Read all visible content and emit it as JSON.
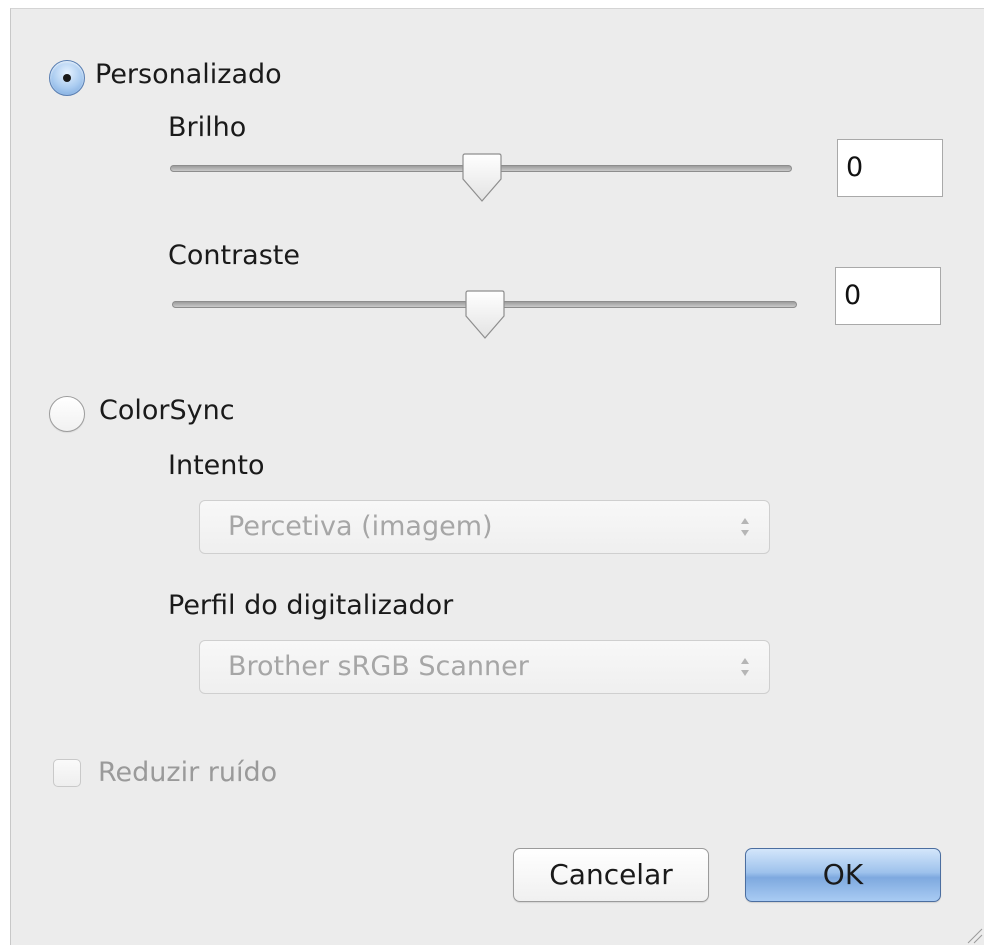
{
  "options": {
    "custom_label": "Personalizado",
    "custom_selected": true,
    "colorsync_label": "ColorSync",
    "colorsync_selected": false
  },
  "brightness": {
    "label": "Brilho",
    "value": "0",
    "slider_fraction": 0.5
  },
  "contrast": {
    "label": "Contraste",
    "value": "0",
    "slider_fraction": 0.5
  },
  "colorsync": {
    "intent_label": "Intento",
    "intent_value": "Percetiva (imagem)",
    "profile_label": "Perfil do digitalizador",
    "profile_value": "Brother sRGB Scanner"
  },
  "noise": {
    "label": "Reduzir ruído",
    "checked": false,
    "enabled": false
  },
  "buttons": {
    "cancel_label": "Cancelar",
    "ok_label": "OK"
  }
}
